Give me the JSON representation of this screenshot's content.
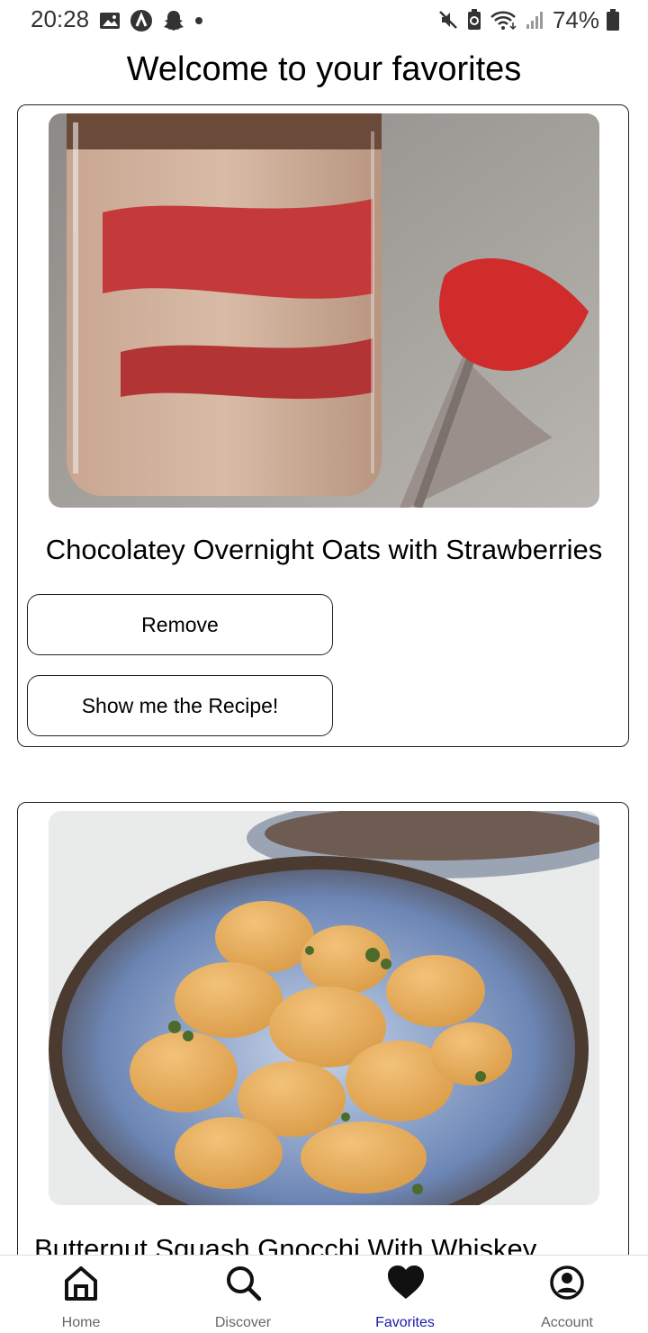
{
  "status_bar": {
    "time": "20:28",
    "battery": "74%",
    "left_icons": [
      "gallery-icon",
      "a-circle-icon",
      "snapchat-icon",
      "dot-icon"
    ],
    "right_icons": [
      "mute-icon",
      "battery-saver-icon",
      "wifi-icon",
      "signal-icon",
      "battery-icon"
    ]
  },
  "page": {
    "title": "Welcome to your favorites"
  },
  "favorites": [
    {
      "title": "Chocolatey Overnight Oats with Strawberries",
      "remove_label": "Remove",
      "show_label": "Show me the Recipe!"
    },
    {
      "title": "Butternut Squash Gnocchi With Whiskey"
    }
  ],
  "bottom_nav": {
    "items": [
      {
        "label": "Home",
        "icon": "home-icon"
      },
      {
        "label": "Discover",
        "icon": "search-icon"
      },
      {
        "label": "Favorites",
        "icon": "heart-icon"
      },
      {
        "label": "Account",
        "icon": "account-icon"
      }
    ],
    "active": "Favorites",
    "active_color": "#1a1aaa",
    "inactive_color": "#666666"
  }
}
